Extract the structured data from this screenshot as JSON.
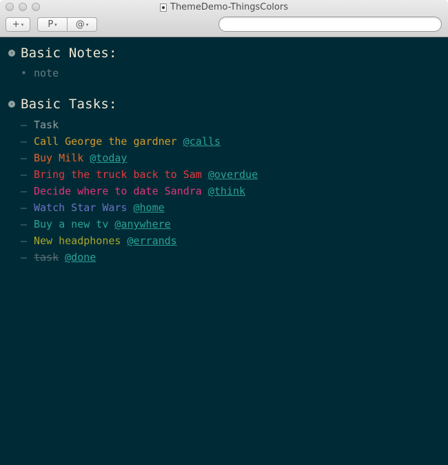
{
  "window": {
    "title": "ThemeDemo-ThingsColors"
  },
  "toolbar": {
    "add_label": "+",
    "project_label": "P",
    "tag_label": "@",
    "caret": "▾",
    "search_placeholder": ""
  },
  "projects": [
    {
      "title": "Basic Notes:",
      "items": [
        {
          "bullet": "•",
          "text": "note",
          "tag": "",
          "color": "#657b83",
          "tag_color": "#2aa198"
        }
      ]
    },
    {
      "title": "Basic Tasks:",
      "items": [
        {
          "bullet": "–",
          "text": "Task",
          "tag": "",
          "color": "#93a1a1",
          "tag_color": "#2aa198"
        },
        {
          "bullet": "–",
          "text": "Call George the gardner",
          "tag": "@calls",
          "color": "#d69a2c",
          "tag_color": "#2aa198"
        },
        {
          "bullet": "–",
          "text": "Buy Milk",
          "tag": "@today",
          "color": "#e0652c",
          "tag_color": "#2aa198"
        },
        {
          "bullet": "–",
          "text": "Bring the truck back to Sam",
          "tag": "@overdue",
          "color": "#e5393d",
          "tag_color": "#2aa198"
        },
        {
          "bullet": "–",
          "text": "Decide where to date Sandra",
          "tag": "@think",
          "color": "#e0357a",
          "tag_color": "#2aa198"
        },
        {
          "bullet": "–",
          "text": "Watch Star Wars",
          "tag": "@home",
          "color": "#6c71c4",
          "tag_color": "#2aa198"
        },
        {
          "bullet": "–",
          "text": "Buy a new tv",
          "tag": "@anywhere",
          "color": "#2aa198",
          "tag_color": "#2aa198"
        },
        {
          "bullet": "–",
          "text": "New headphones",
          "tag": "@errands",
          "color": "#a9a628",
          "tag_color": "#2aa198"
        },
        {
          "bullet": "–",
          "text": "task",
          "tag": "@done",
          "color": "#586e75",
          "tag_color": "#2aa198",
          "done": true
        }
      ]
    }
  ]
}
